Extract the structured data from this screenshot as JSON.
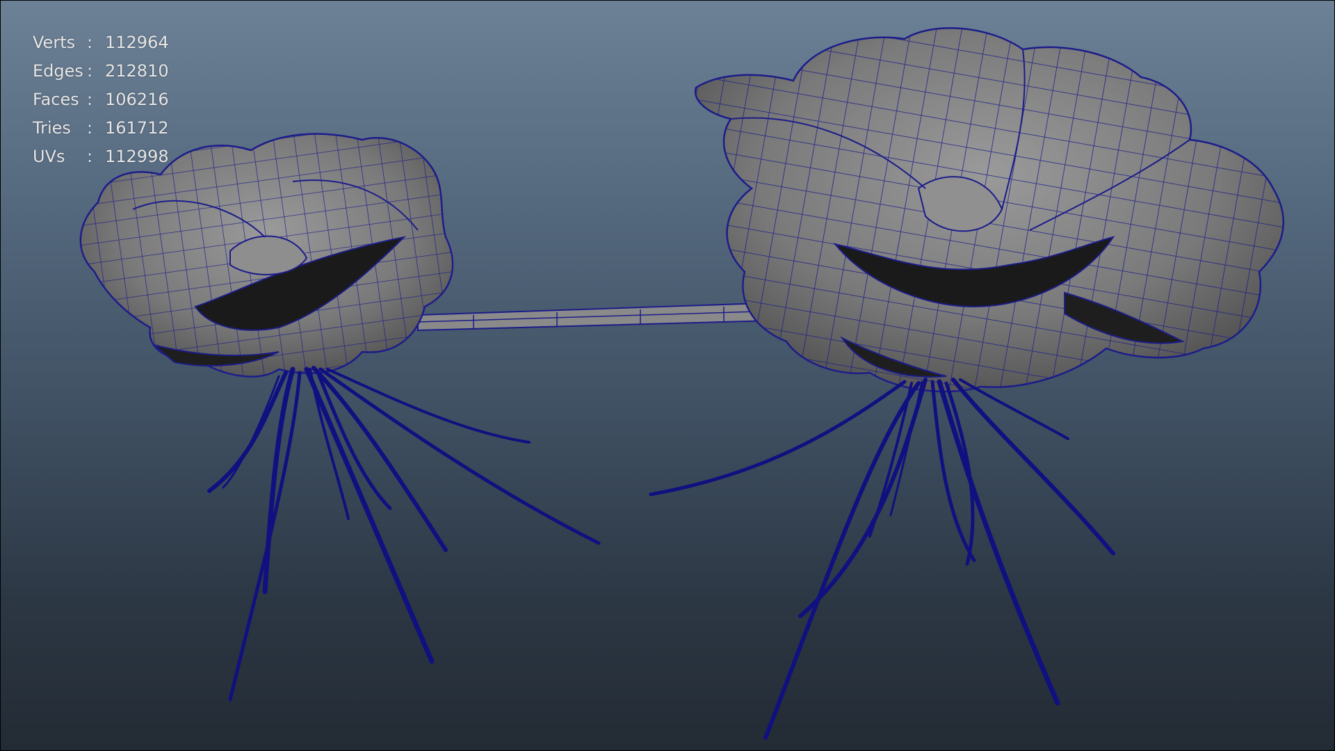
{
  "stats": [
    {
      "label": "Verts",
      "colon": ":",
      "value": "112964"
    },
    {
      "label": "Edges",
      "colon": ":",
      "value": "212810"
    },
    {
      "label": "Faces",
      "colon": ":",
      "value": "106216"
    },
    {
      "label": "Tries",
      "colon": ":",
      "value": "161712"
    },
    {
      "label": "UVs",
      "colon": ":",
      "value": "112998"
    }
  ],
  "colors": {
    "background_top": "#6c8196",
    "background_bottom": "#232b34",
    "mesh_fill": "#7a7a7a",
    "wireframe": "#1c1c8a",
    "roots": "#101080",
    "hud_text": "#e6e6e6"
  }
}
